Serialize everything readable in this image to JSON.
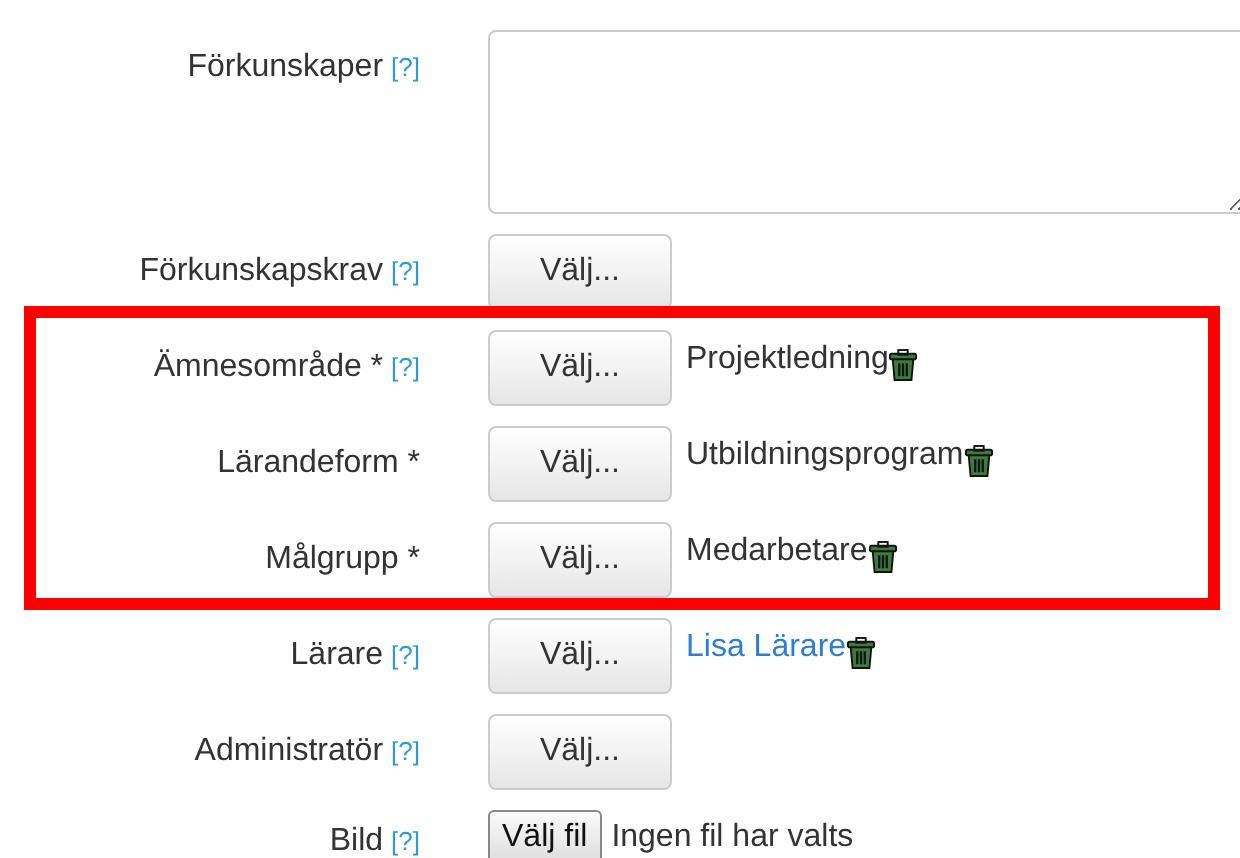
{
  "sections": [
    {
      "highlighted": false,
      "fields": [
        {
          "kind": "textarea",
          "label": "Förkunskaper",
          "help": "[?]"
        },
        {
          "kind": "chooser",
          "label": "Förkunskapskrav",
          "help": "[?]",
          "button": "Välj..."
        }
      ]
    },
    {
      "highlighted": true,
      "fields": [
        {
          "kind": "chooser",
          "label": "Ämnesområde *",
          "help": "[?]",
          "button": "Välj...",
          "value": {
            "text": "Projektledning",
            "link": false
          }
        },
        {
          "kind": "chooser",
          "label": "Lärandeform *",
          "button": "Välj...",
          "value": {
            "text": "Utbildningsprogram",
            "link": false
          }
        },
        {
          "kind": "chooser",
          "label": "Målgrupp *",
          "button": "Välj...",
          "value": {
            "text": "Medarbetare",
            "link": false
          }
        }
      ]
    },
    {
      "highlighted": false,
      "fields": [
        {
          "kind": "chooser",
          "label": "Lärare",
          "help": "[?]",
          "button": "Välj...",
          "value": {
            "text": "Lisa Lärare",
            "link": true
          }
        },
        {
          "kind": "chooser",
          "label": "Administratör",
          "help": "[?]",
          "button": "Välj..."
        },
        {
          "kind": "file",
          "label": "Bild",
          "help": "[?]",
          "button": "Välj fil",
          "status": "Ingen fil har valts"
        }
      ]
    }
  ]
}
